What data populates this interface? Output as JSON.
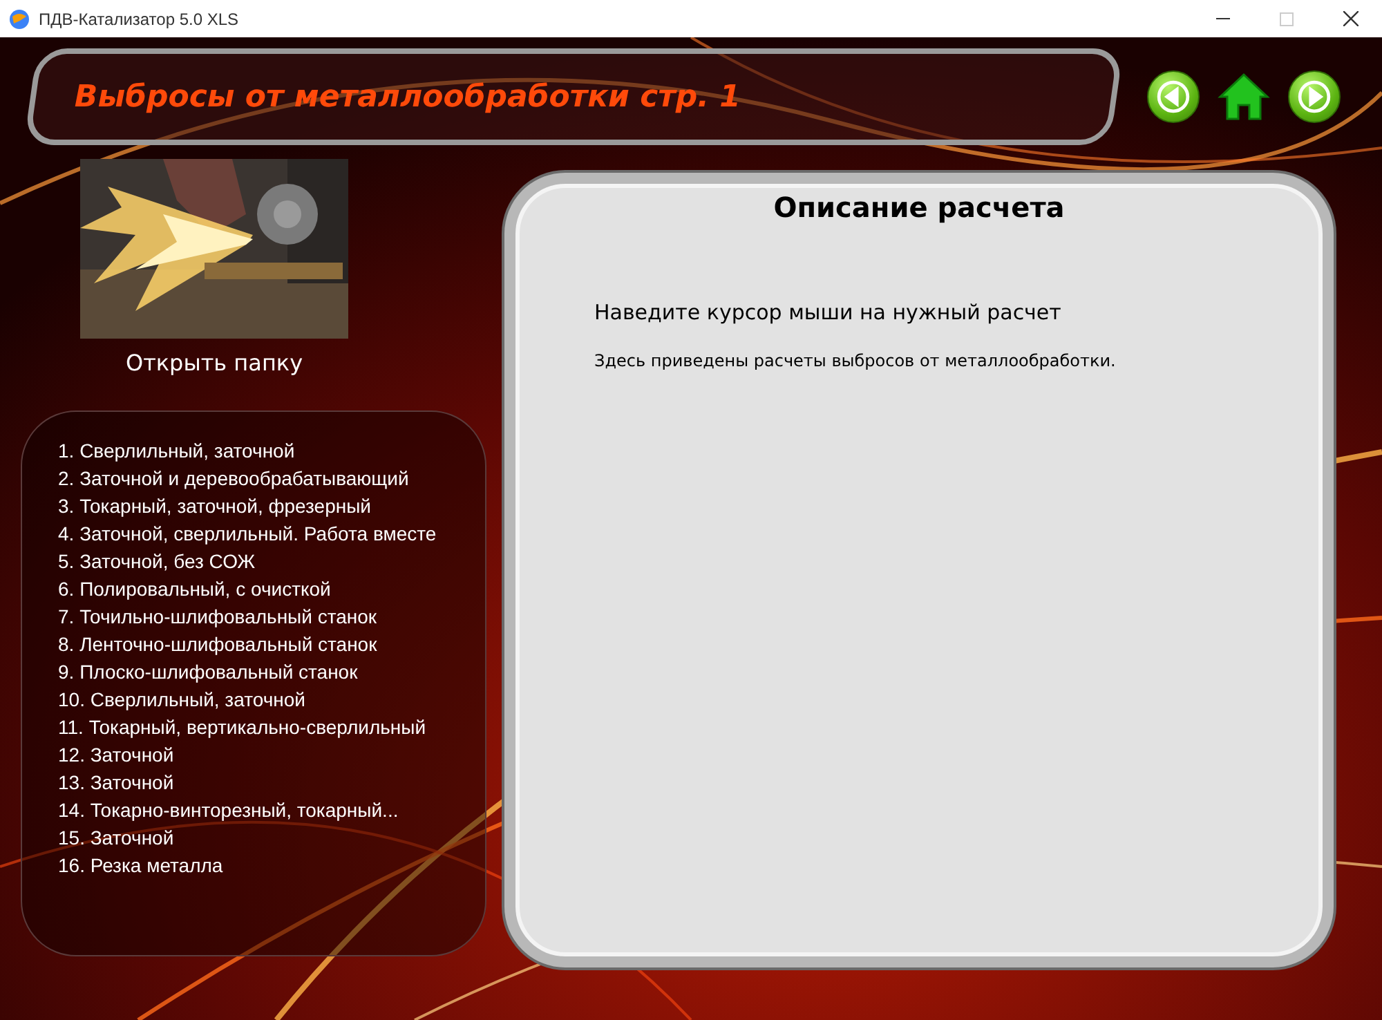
{
  "window": {
    "title": "ПДВ-Катализатор 5.0 XLS"
  },
  "header": {
    "title": "Выбросы от металлообработки стр. 1"
  },
  "nav": [
    {
      "kind": "back"
    },
    {
      "kind": "home"
    },
    {
      "kind": "forward"
    }
  ],
  "folder": {
    "label": "Открыть папку"
  },
  "calculations": [
    {
      "label": "1. Сверлильный, заточной"
    },
    {
      "label": "2. Заточной и деревообрабатывающий"
    },
    {
      "label": "3. Токарный, заточной, фрезерный"
    },
    {
      "label": "4. Заточной, сверлильный. Работа вместе"
    },
    {
      "label": "5. Заточной, без СОЖ"
    },
    {
      "label": "6. Полировальный, с очисткой"
    },
    {
      "label": "7. Точильно-шлифовальный станок"
    },
    {
      "label": "8. Ленточно-шлифовальный станок"
    },
    {
      "label": "9. Плоско-шлифовальный станок"
    },
    {
      "label": "10. Сверлильный, заточной"
    },
    {
      "label": "11. Токарный, вертикально-сверлильный"
    },
    {
      "label": "12. Заточной"
    },
    {
      "label": "13. Заточной"
    },
    {
      "label": "14. Токарно-винторезный, токарный..."
    },
    {
      "label": "15. Заточной"
    },
    {
      "label": "16. Резка металла"
    }
  ],
  "description": {
    "title": "Описание расчета",
    "hint": "Наведите курсор мыши на нужный расчет",
    "text": "Здесь приведены расчеты выбросов от металлообработки."
  }
}
